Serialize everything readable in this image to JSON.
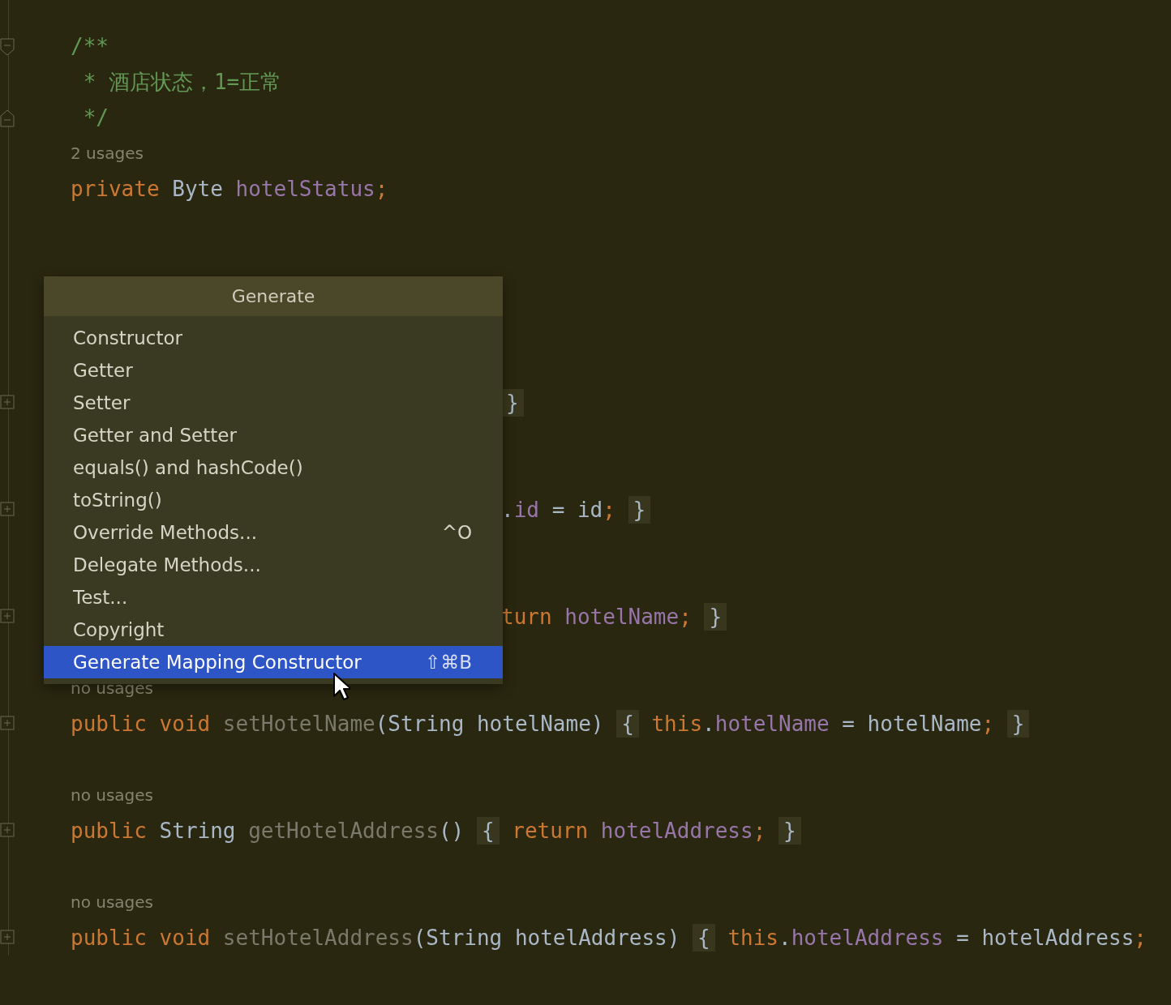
{
  "editor": {
    "lines": [
      {
        "kind": "fold_open",
        "tokens": [
          {
            "kind": "comment",
            "text": "/**"
          }
        ]
      },
      {
        "kind": "text",
        "tokens": [
          {
            "kind": "comment",
            "text": " * 酒店状态，1=正常"
          }
        ]
      },
      {
        "kind": "fold_close",
        "tokens": [
          {
            "kind": "comment",
            "text": " */"
          }
        ]
      },
      {
        "kind": "text",
        "tokens": [
          {
            "kind": "hint",
            "text": "2 usages"
          }
        ]
      },
      {
        "kind": "text",
        "tokens": [
          {
            "kind": "keyword",
            "text": "private"
          },
          {
            "kind": "type",
            "text": "Byte",
            "gap": true
          },
          {
            "kind": "field",
            "text": "hotelStatus",
            "gap": true
          },
          {
            "kind": "punct",
            "text": ";"
          }
        ]
      },
      {
        "kind": "blank"
      },
      {
        "kind": "blank"
      },
      {
        "kind": "blank"
      },
      {
        "kind": "blank"
      },
      {
        "kind": "blank"
      },
      {
        "kind": "collapsed",
        "partial": true,
        "tokens": [
          {
            "kind": "brace",
            "text": "}"
          }
        ]
      },
      {
        "kind": "blank"
      },
      {
        "kind": "blank"
      },
      {
        "kind": "collapsed",
        "partial": true,
        "tokens": [
          {
            "kind": "plain",
            "text": "."
          },
          {
            "kind": "field",
            "text": "id"
          },
          {
            "kind": "plain",
            "text": "=",
            "gap": true
          },
          {
            "kind": "plain",
            "text": "id",
            "gap": true
          },
          {
            "kind": "punct",
            "text": ";"
          },
          {
            "kind": "brace",
            "text": "}",
            "gap": true
          }
        ]
      },
      {
        "kind": "blank"
      },
      {
        "kind": "blank"
      },
      {
        "kind": "collapsed",
        "partial": true,
        "tokens": [
          {
            "kind": "keyword",
            "text": "turn"
          },
          {
            "kind": "field",
            "text": "hotelName",
            "gap": true
          },
          {
            "kind": "punct",
            "text": ";"
          },
          {
            "kind": "brace",
            "text": "}",
            "gap": true
          }
        ]
      },
      {
        "kind": "blank"
      },
      {
        "kind": "text",
        "tokens": [
          {
            "kind": "hint",
            "text": "no usages"
          }
        ]
      },
      {
        "kind": "collapsed",
        "tokens": [
          {
            "kind": "keyword",
            "text": "public"
          },
          {
            "kind": "keyword",
            "text": "void",
            "gap": true
          },
          {
            "kind": "unused",
            "text": "setHotelName",
            "gap": true
          },
          {
            "kind": "plain",
            "text": "("
          },
          {
            "kind": "type",
            "text": "String"
          },
          {
            "kind": "plain",
            "text": "hotelName)",
            "gap": true
          },
          {
            "kind": "brace",
            "text": "{",
            "gap": true
          },
          {
            "kind": "keyword",
            "text": "this",
            "gap": true
          },
          {
            "kind": "plain",
            "text": "."
          },
          {
            "kind": "field",
            "text": "hotelName"
          },
          {
            "kind": "plain",
            "text": "=",
            "gap": true
          },
          {
            "kind": "plain",
            "text": "hotelName",
            "gap": true
          },
          {
            "kind": "punct",
            "text": ";"
          },
          {
            "kind": "brace",
            "text": "}",
            "gap": true
          }
        ]
      },
      {
        "kind": "blank"
      },
      {
        "kind": "text",
        "tokens": [
          {
            "kind": "hint",
            "text": "no usages"
          }
        ]
      },
      {
        "kind": "collapsed",
        "tokens": [
          {
            "kind": "keyword",
            "text": "public"
          },
          {
            "kind": "type",
            "text": "String",
            "gap": true
          },
          {
            "kind": "unused",
            "text": "getHotelAddress",
            "gap": true
          },
          {
            "kind": "plain",
            "text": "()"
          },
          {
            "kind": "brace",
            "text": "{",
            "gap": true
          },
          {
            "kind": "keyword",
            "text": "return",
            "gap": true
          },
          {
            "kind": "field",
            "text": "hotelAddress",
            "gap": true
          },
          {
            "kind": "punct",
            "text": ";"
          },
          {
            "kind": "brace",
            "text": "}",
            "gap": true
          }
        ]
      },
      {
        "kind": "blank"
      },
      {
        "kind": "text",
        "tokens": [
          {
            "kind": "hint",
            "text": "no usages"
          }
        ]
      },
      {
        "kind": "collapsed",
        "tokens": [
          {
            "kind": "keyword",
            "text": "public"
          },
          {
            "kind": "keyword",
            "text": "void",
            "gap": true
          },
          {
            "kind": "unused",
            "text": "setHotelAddress",
            "gap": true
          },
          {
            "kind": "plain",
            "text": "("
          },
          {
            "kind": "type",
            "text": "String"
          },
          {
            "kind": "plain",
            "text": "hotelAddress)",
            "gap": true
          },
          {
            "kind": "brace",
            "text": "{",
            "gap": true
          },
          {
            "kind": "keyword",
            "text": "this",
            "gap": true
          },
          {
            "kind": "plain",
            "text": "."
          },
          {
            "kind": "field",
            "text": "hotelAddress"
          },
          {
            "kind": "plain",
            "text": "=",
            "gap": true
          },
          {
            "kind": "plain",
            "text": "hotelAddress",
            "gap": true
          },
          {
            "kind": "punct",
            "text": ";"
          }
        ]
      }
    ]
  },
  "popup": {
    "title": "Generate",
    "items": [
      {
        "label": "Constructor",
        "selected": false
      },
      {
        "label": "Getter",
        "selected": false
      },
      {
        "label": "Setter",
        "selected": false
      },
      {
        "label": "Getter and Setter",
        "selected": false
      },
      {
        "label": "equals() and hashCode()",
        "selected": false
      },
      {
        "label": "toString()",
        "selected": false
      },
      {
        "label": "Override Methods...",
        "shortcut": "^O",
        "selected": false
      },
      {
        "label": "Delegate Methods...",
        "selected": false
      },
      {
        "label": "Test...",
        "selected": false
      },
      {
        "label": "Copyright",
        "selected": false
      },
      {
        "label": "Generate Mapping Constructor",
        "shortcut": "⇧⌘B",
        "selected": true
      }
    ]
  }
}
